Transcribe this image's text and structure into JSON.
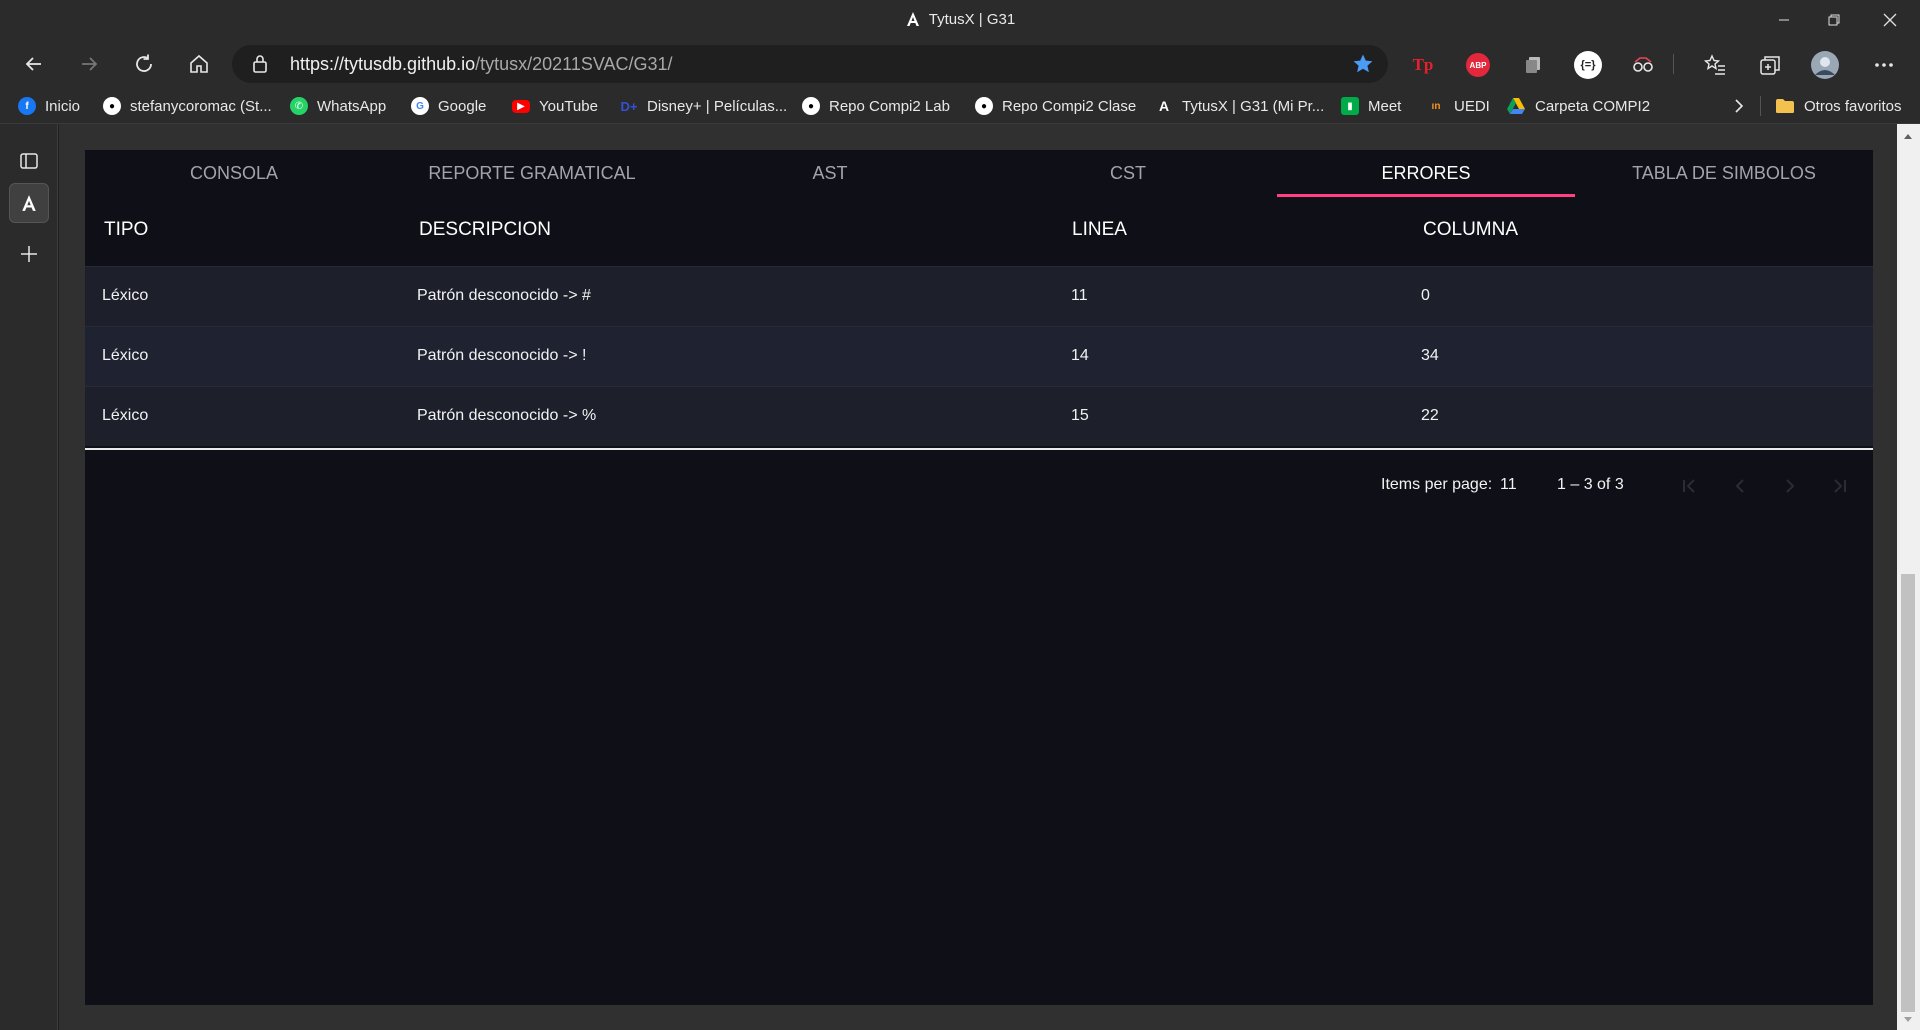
{
  "window": {
    "title": "TytusX | G31",
    "minimize_label": "—",
    "restore_label": "❐",
    "close_label": "✕"
  },
  "toolbar": {
    "url_host": "https://tytusdb.github.io",
    "url_path": "/tytusx/20211SVAC/G31/",
    "extensions": [
      "Tp",
      "ABP",
      "{=}"
    ]
  },
  "bookmarks": [
    {
      "label": "Inicio",
      "icon": "facebook-icon",
      "color": "#1877f2"
    },
    {
      "label": "stefanycoromac (St...",
      "icon": "github-icon",
      "color": "#ffffff"
    },
    {
      "label": "WhatsApp",
      "icon": "whatsapp-icon",
      "color": "#25d366"
    },
    {
      "label": "Google",
      "icon": "google-icon",
      "color": "#ffffff"
    },
    {
      "label": "YouTube",
      "icon": "youtube-icon",
      "color": "#ff0000"
    },
    {
      "label": "Disney+ | Películas...",
      "icon": "disney-icon",
      "color": "#1b3fc4"
    },
    {
      "label": "Repo Compi2 Lab",
      "icon": "github-icon",
      "color": "#ffffff"
    },
    {
      "label": "Repo Compi2 Clase",
      "icon": "github-icon",
      "color": "#ffffff"
    },
    {
      "label": "TytusX | G31 (Mi Pr...",
      "icon": "angular-icon",
      "color": "#ffffff"
    },
    {
      "label": "Meet",
      "icon": "meet-icon",
      "color": "#00ac47"
    },
    {
      "label": "UEDI",
      "icon": "uedi-icon",
      "color": "#f7941d"
    },
    {
      "label": "Carpeta COMPI2",
      "icon": "drive-icon",
      "color": "#fbbc04"
    }
  ],
  "other_favorites": "Otros favoritos",
  "tabs": [
    {
      "label": "CONSOLA",
      "active": false
    },
    {
      "label": "REPORTE GRAMATICAL",
      "active": false
    },
    {
      "label": "AST",
      "active": false
    },
    {
      "label": "CST",
      "active": false
    },
    {
      "label": "ERRORES",
      "active": true
    },
    {
      "label": "TABLA DE SIMBOLOS",
      "active": false
    }
  ],
  "table": {
    "headers": [
      "TIPO",
      "DESCRIPCION",
      "LINEA",
      "COLUMNA"
    ],
    "rows": [
      [
        "Léxico",
        "Patrón desconocido -> #",
        "11",
        "0"
      ],
      [
        "Léxico",
        "Patrón desconocido -> !",
        "14",
        "34"
      ],
      [
        "Léxico",
        "Patrón desconocido -> %",
        "15",
        "22"
      ]
    ]
  },
  "paginator": {
    "items_per_page_label": "Items per page:",
    "page_size": "11",
    "range_label": "1 – 3 of 3"
  },
  "colors": {
    "accent": "#ff4081",
    "card_bg": "#0e0f17",
    "row_bg": "#1d1f2b"
  }
}
